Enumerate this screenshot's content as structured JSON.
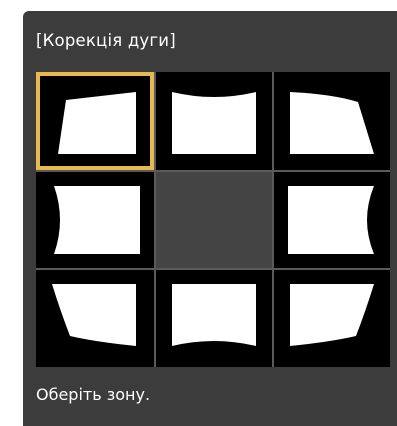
{
  "dialog": {
    "title": "[Корекція дуги]",
    "hint": "Оберіть зону.",
    "selected_zone": "top-left",
    "colors": {
      "panel": "#3c3c3c",
      "selection": "#e8b94c",
      "screen": "#ffffff",
      "cell": "#000000"
    }
  },
  "zones": [
    {
      "id": "top-left",
      "icon": "keystone-corner-icon",
      "selected": true
    },
    {
      "id": "top",
      "icon": "arc-top-icon",
      "selected": false
    },
    {
      "id": "top-right",
      "icon": "arc-top-right-icon",
      "selected": false
    },
    {
      "id": "left",
      "icon": "arc-left-icon",
      "selected": false
    },
    {
      "id": "center",
      "icon": "",
      "selected": false
    },
    {
      "id": "right",
      "icon": "arc-right-icon",
      "selected": false
    },
    {
      "id": "bottom-left",
      "icon": "arc-bottom-left-icon",
      "selected": false
    },
    {
      "id": "bottom",
      "icon": "arc-bottom-icon",
      "selected": false
    },
    {
      "id": "bottom-right",
      "icon": "arc-bottom-right-icon",
      "selected": false
    }
  ]
}
